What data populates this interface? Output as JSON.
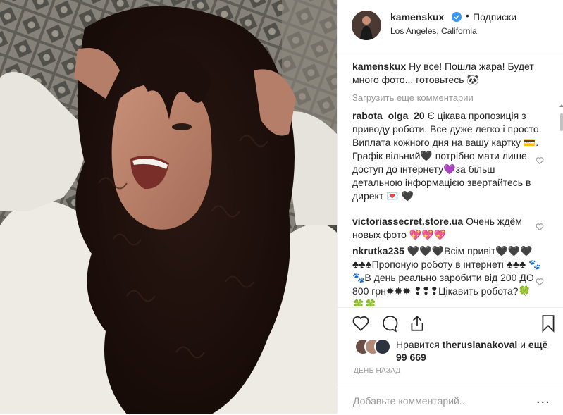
{
  "post": {
    "username": "kamenskux",
    "separator": "•",
    "follow_label": "Подписки",
    "location": "Los Angeles, California",
    "accent_color": "#3897f0"
  },
  "caption": {
    "username": "kamenskux",
    "text": "Ну все! Пошла жара! Будет много фото... готовьтесь 🐼"
  },
  "load_more_label": "Загрузить еще комментарии",
  "comments": [
    {
      "username": "rabota_olga_20",
      "text": "Є цікава пропозиція з приводу роботи. Все дуже легко і просто. Виплата кожного дня на вашу картку 💳. Графік вільний🖤 потрібно мати лише доступ до інтернету💜за більш детальною інформацією звертайтесь в директ 💌 🖤"
    },
    {
      "username": "victoriassecret.store.ua",
      "text": "Очень ждём новых фото 💖💖💖"
    },
    {
      "username": "nkrutka235",
      "text": "🖤🖤🖤Всім привіт🖤🖤🖤 ♣♣♣Пропоную роботу в інтернеті ♣♣♣ 🐾🐾В день реально заробити від 200 ДО 800 грн✸✸✸ ❢❢❢Цікавить робота?🍀🍀🍀"
    }
  ],
  "likes": {
    "prefix": "Нравится",
    "user": "theruslanakoval",
    "connector": "и",
    "suffix": "ещё 99 669"
  },
  "time_label": "ДЕНЬ НАЗАД",
  "add_comment_placeholder": "Добавьте комментарий...",
  "more_label": "..."
}
